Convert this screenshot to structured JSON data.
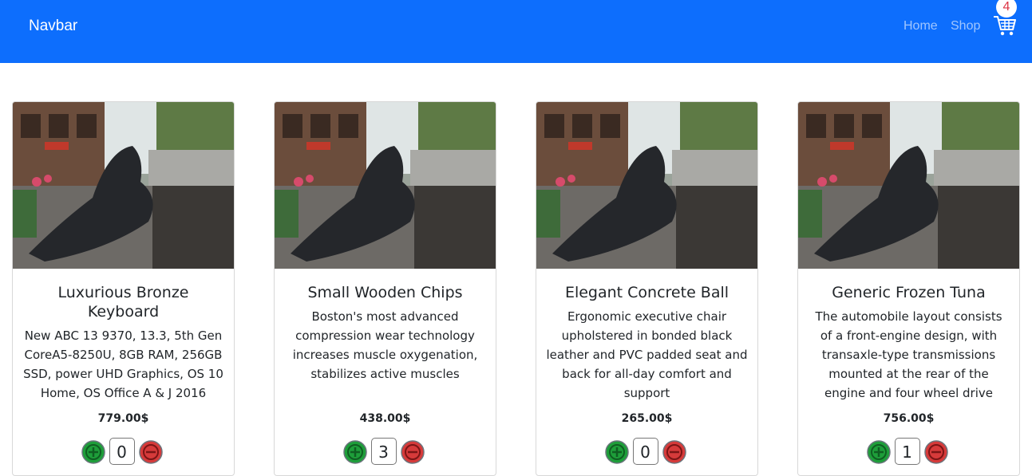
{
  "navbar": {
    "brand": "Navbar",
    "links": [
      "Home",
      "Shop"
    ],
    "cart_count": "4",
    "cart_icon": "cart-icon"
  },
  "colors": {
    "navbar": "#0d6efd",
    "plus_button": "#1e9e3a",
    "minus_button": "#d63a3a"
  },
  "products": [
    {
      "title": "Luxurious Bronze Keyboard",
      "description": "New ABC 13 9370, 13.3, 5th Gen CoreA5-8250U, 8GB RAM, 256GB SSD, power UHD Graphics, OS 10 Home, OS Office A & J 2016",
      "price": "779.00$",
      "quantity": "0"
    },
    {
      "title": "Small Wooden Chips",
      "description": "Boston's most advanced compression wear technology increases muscle oxygenation, stabilizes active muscles",
      "price": "438.00$",
      "quantity": "3"
    },
    {
      "title": "Elegant Concrete Ball",
      "description": "Ergonomic executive chair upholstered in bonded black leather and PVC padded seat and back for all-day comfort and support",
      "price": "265.00$",
      "quantity": "0"
    },
    {
      "title": "Generic Frozen Tuna",
      "description": "The automobile layout consists of a front-engine design, with transaxle-type transmissions mounted at the rear of the engine and four wheel drive",
      "price": "756.00$",
      "quantity": "1"
    }
  ]
}
